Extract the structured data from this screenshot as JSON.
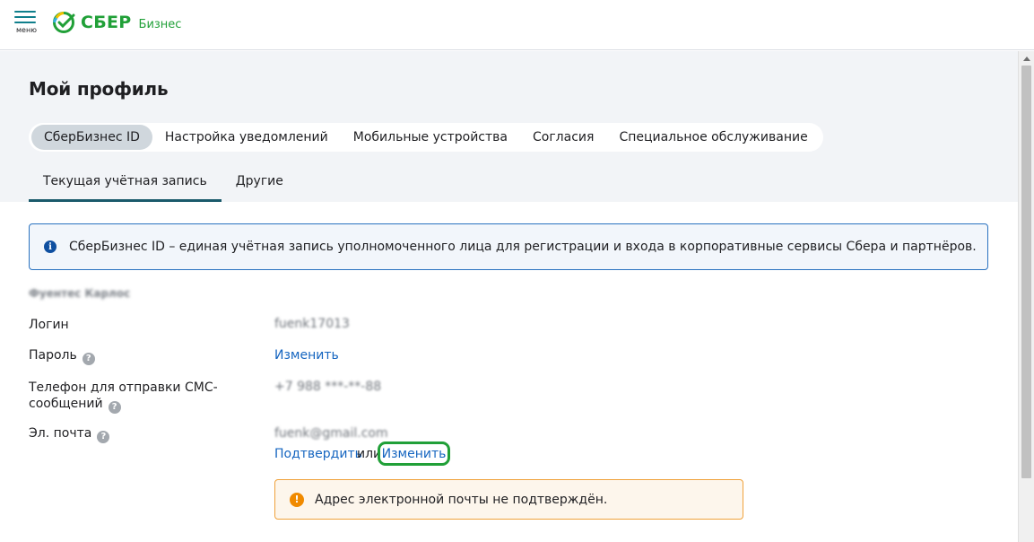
{
  "header": {
    "menu_label": "меню",
    "brand": "СБЕР",
    "brand_sub": "Бизнес"
  },
  "page": {
    "title": "Мой профиль"
  },
  "tabs": [
    {
      "label": "СберБизнес ID",
      "active": true
    },
    {
      "label": "Настройка уведомлений",
      "active": false
    },
    {
      "label": "Мобильные устройства",
      "active": false
    },
    {
      "label": "Согласия",
      "active": false
    },
    {
      "label": "Специальное обслуживание",
      "active": false
    }
  ],
  "subtabs": [
    {
      "label": "Текущая учётная запись",
      "active": true
    },
    {
      "label": "Другие",
      "active": false
    }
  ],
  "info": {
    "text": "СберБизнес ID – единая учётная запись уполномоченного лица для регистрации и входа в корпоративные сервисы Сбера и партнёров."
  },
  "profile": {
    "name": "Фуентес Карлос",
    "login_label": "Логин",
    "login_value": "fuenk17013",
    "password_label": "Пароль",
    "password_change": "Изменить",
    "phone_label": "Телефон для отправки СМС-сообщений",
    "phone_value": "+7 988 ***-**-88",
    "email_label": "Эл. почта",
    "email_value": "fuenk@gmail.com",
    "email_confirm": "Подтвердить",
    "email_or": "или",
    "email_change": "Изменить"
  },
  "warning": {
    "text": "Адрес электронной почты не подтверждён."
  },
  "colors": {
    "brand_green": "#21a038",
    "link_blue": "#1565c0",
    "info_border": "#2a72c0",
    "warn_border": "#f0a23c",
    "tab_underline": "#1a5a6b"
  }
}
